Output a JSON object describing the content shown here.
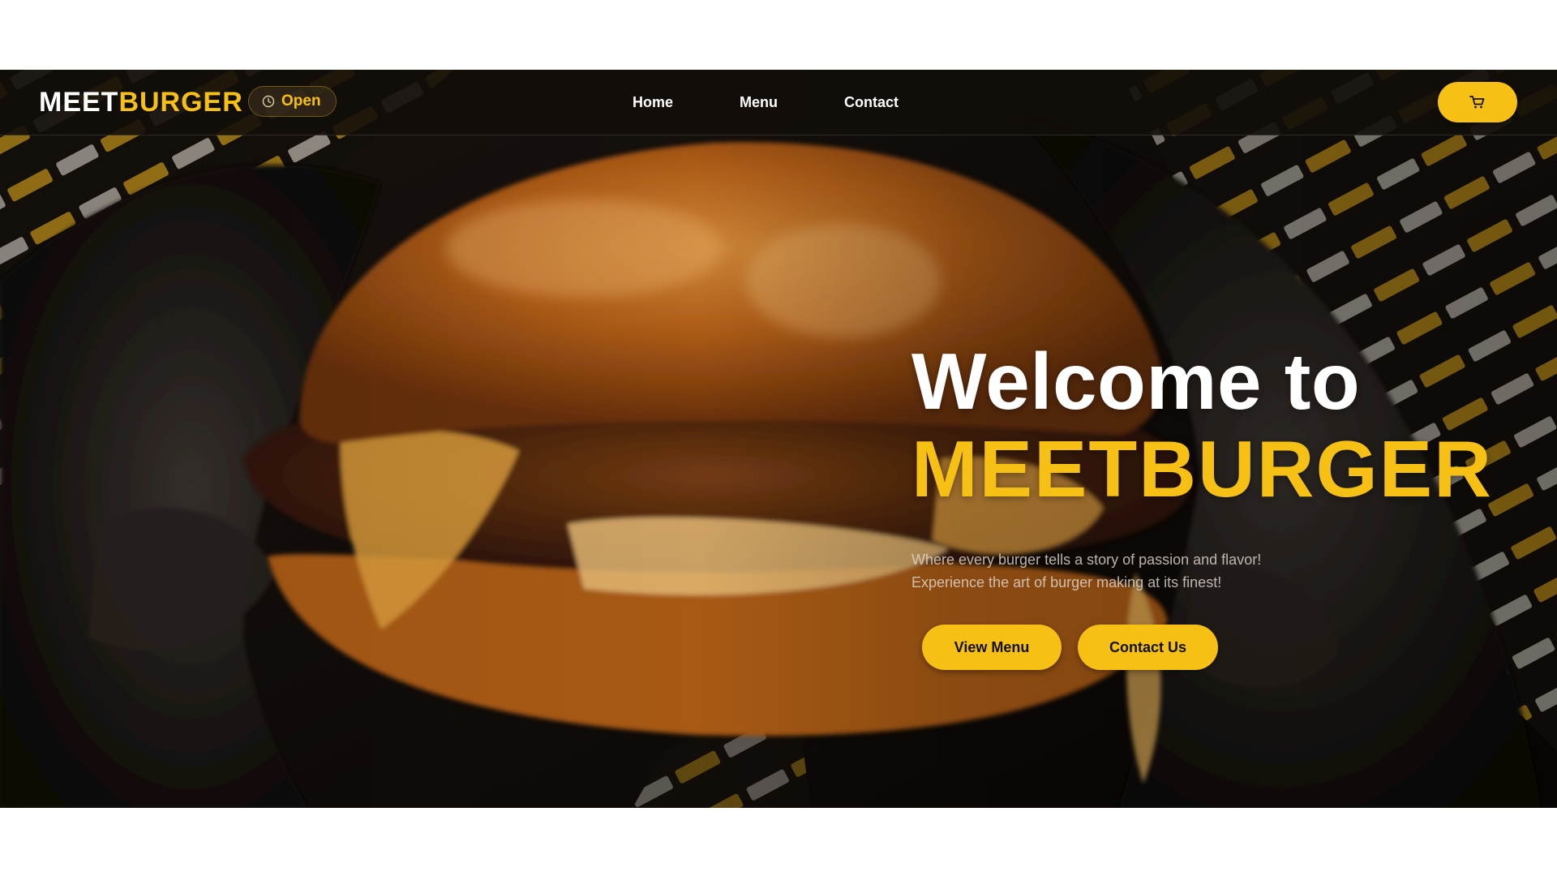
{
  "brand": {
    "logo_part1": "MEET",
    "logo_part2": "BURGER",
    "status": "Open"
  },
  "nav": {
    "items": [
      "Home",
      "Menu",
      "Contact"
    ]
  },
  "hero": {
    "welcome": "Welcome to",
    "brand_title": "MEETBURGER",
    "tagline_line1": "Where every burger tells a story of passion and flavor!",
    "tagline_line2": "Experience the art of burger making at its finest!",
    "buttons": {
      "view_menu": "View Menu",
      "contact_us": "Contact Us"
    }
  },
  "icons": {
    "status": "clock-icon",
    "cart": "shopping-cart-icon"
  },
  "colors": {
    "accent": "#f6c015",
    "nav_background": "#120d09",
    "text_primary": "#ffffff"
  }
}
